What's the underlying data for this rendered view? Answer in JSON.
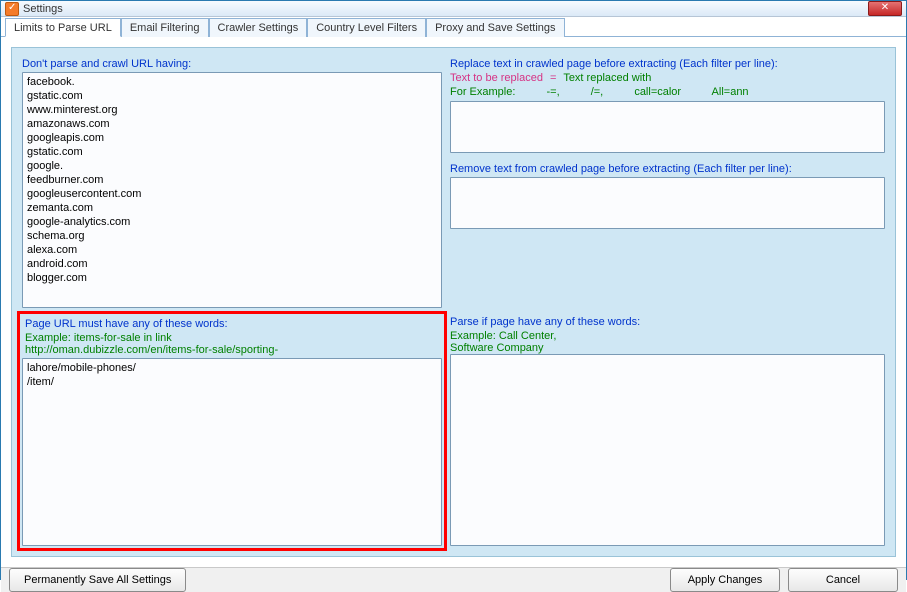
{
  "window": {
    "title": "Settings"
  },
  "tabs": [
    {
      "label": "Limits to Parse URL"
    },
    {
      "label": "Email Filtering"
    },
    {
      "label": "Crawler Settings"
    },
    {
      "label": "Country Level Filters"
    },
    {
      "label": "Proxy and Save Settings"
    }
  ],
  "left_top": {
    "label": "Don't parse and crawl URL having:",
    "value": "facebook.\ngstatic.com\nwww.minterest.org\namazonaws.com\ngoogleapis.com\ngstatic.com\ngoogle.\nfeedburner.com\ngoogleusercontent.com\nzemanta.com\ngoogle-analytics.com\nschema.org\nalexa.com\nandroid.com\nblogger.com"
  },
  "left_bottom": {
    "label": "Page URL must have any of these words:",
    "example1": "Example: items-for-sale in link",
    "example2": "http://oman.dubizzle.com/en/items-for-sale/sporting-",
    "value": "lahore/mobile-phones/\n/item/"
  },
  "right_top1": {
    "label": "Replace text in crawled page before extracting (Each filter per line):",
    "legend_left": "Text to be replaced",
    "legend_eq": "=",
    "legend_right": "Text replaced with",
    "example_lead": "For Example:",
    "ex1": "-=,",
    "ex2": "/=,",
    "ex3": "call=calor",
    "ex4": "All=ann",
    "value": ""
  },
  "right_top2": {
    "label": "Remove text from crawled page before extracting (Each filter per line):",
    "value": ""
  },
  "right_bottom": {
    "label": "Parse if page have any of these words:",
    "example1": "Example: Call Center,",
    "example2": "Software Company",
    "value": ""
  },
  "footer": {
    "save": "Permanently Save All Settings",
    "apply": "Apply Changes",
    "cancel": "Cancel"
  }
}
